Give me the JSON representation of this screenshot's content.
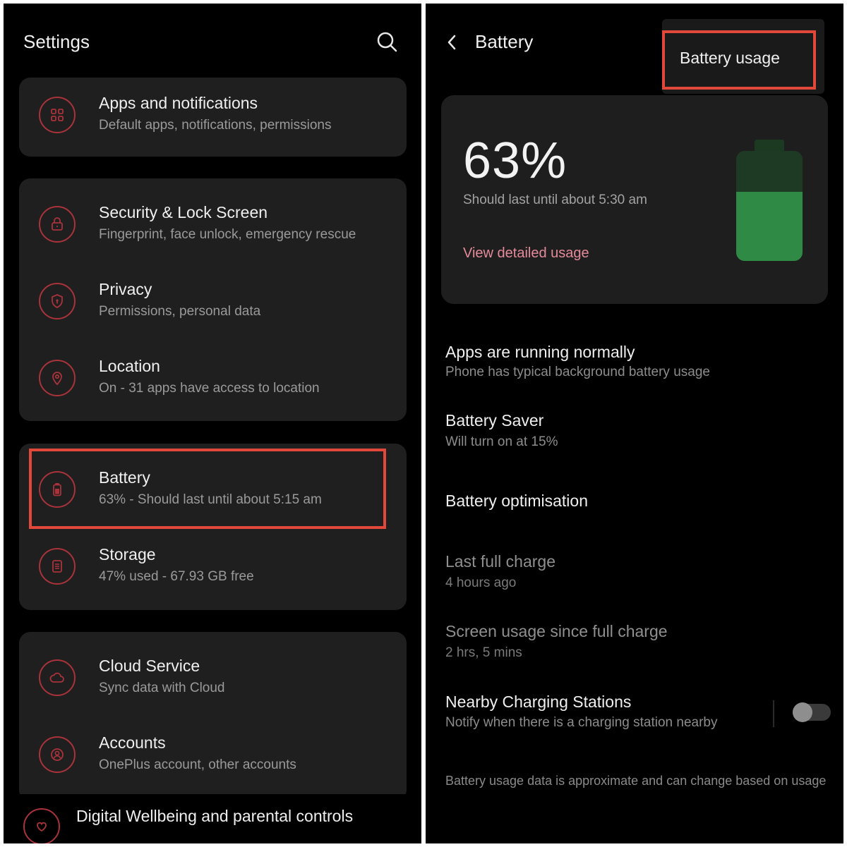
{
  "left": {
    "title": "Settings",
    "groups": [
      {
        "items": [
          {
            "title": "Apps and notifications",
            "subtitle": "Default apps, notifications, permissions",
            "icon": "apps-grid-icon"
          }
        ]
      },
      {
        "items": [
          {
            "title": "Security & Lock Screen",
            "subtitle": "Fingerprint, face unlock, emergency rescue",
            "icon": "lock-icon"
          },
          {
            "title": "Privacy",
            "subtitle": "Permissions, personal data",
            "icon": "shield-icon"
          },
          {
            "title": "Location",
            "subtitle": "On - 31 apps have access to location",
            "icon": "location-pin-icon"
          }
        ]
      },
      {
        "items": [
          {
            "title": "Battery",
            "subtitle": "63% - Should last until about 5:15 am",
            "icon": "battery-icon"
          },
          {
            "title": "Storage",
            "subtitle": "47% used - 67.93 GB free",
            "icon": "storage-icon"
          }
        ]
      },
      {
        "items": [
          {
            "title": "Cloud Service",
            "subtitle": "Sync data with Cloud",
            "icon": "cloud-icon"
          },
          {
            "title": "Accounts",
            "subtitle": "OnePlus account, other accounts",
            "icon": "account-icon"
          }
        ]
      }
    ],
    "partial_item": {
      "title": "Digital Wellbeing and parental controls",
      "icon": "wellbeing-icon"
    }
  },
  "right": {
    "title": "Battery",
    "menu": {
      "item": "Battery usage"
    },
    "card": {
      "level_label": "63%",
      "level": 0.63,
      "estimate": "Should last until about 5:30 am",
      "link": "View detailed usage"
    },
    "rows": [
      {
        "title": "Apps are running normally",
        "subtitle": "Phone has typical background battery usage"
      },
      {
        "title": "Battery Saver",
        "subtitle": "Will turn on at 15%"
      },
      {
        "title": "Battery optimisation"
      },
      {
        "title": "Last full charge",
        "subtitle": "4 hours ago"
      },
      {
        "title": "Screen usage since full charge",
        "subtitle": "2 hrs, 5 mins"
      },
      {
        "title": "Nearby Charging Stations",
        "subtitle": "Notify when there is a charging station nearby",
        "toggle_on": false
      }
    ],
    "footnote": "Battery usage data is approximate and can change based on usage"
  },
  "colors": {
    "accent": "#a8333b",
    "highlight": "#e2483a",
    "battery_fill": "#2f8a45",
    "link": "#e58a9a"
  }
}
